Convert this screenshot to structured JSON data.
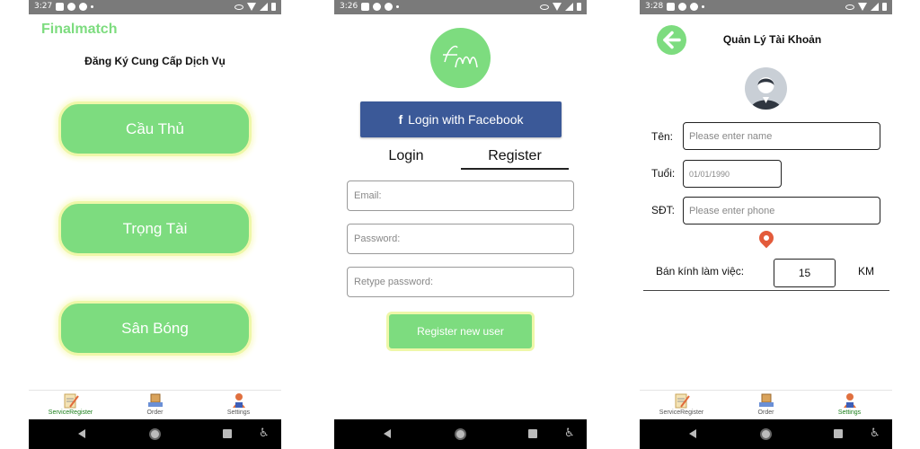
{
  "screens": {
    "service_register": {
      "status_time": "3:27",
      "app_title": "Finalmatch",
      "heading": "Đăng Ký Cung Cấp Dịch Vụ",
      "buttons": {
        "player": "Cầu Thủ",
        "referee": "Trọng Tài",
        "field": "Sân Bóng"
      }
    },
    "register": {
      "status_time": "3:26",
      "logo_text": "fm",
      "facebook_label": "Login with Facebook",
      "tabs": {
        "login": "Login",
        "register": "Register"
      },
      "fields": {
        "email_placeholder": "Email:",
        "password_placeholder": "Password:",
        "retype_placeholder": "Retype password:"
      },
      "register_button": "Register new user"
    },
    "account": {
      "status_time": "3:28",
      "heading": "Quản Lý Tài Khoản",
      "name_label": "Tên:",
      "name_placeholder": "Please enter name",
      "age_label": "Tuổi:",
      "age_placeholder": "01/01/1990",
      "phone_label": "SĐT:",
      "phone_placeholder": "Please enter phone",
      "radius_label": "Bán kính làm việc:",
      "radius_value": "15",
      "radius_unit": "KM"
    }
  },
  "bottom_nav": {
    "service_register": "ServiceRegister",
    "order": "Order",
    "settings": "Settings"
  },
  "colors": {
    "accent_green": "#7ddc7f",
    "facebook_blue": "#3b5998",
    "active_nav": "#1a7f1a"
  }
}
